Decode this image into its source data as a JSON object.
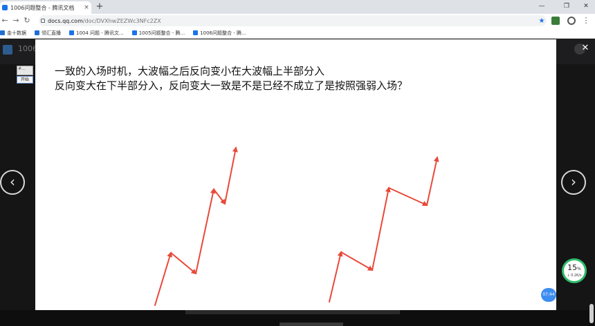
{
  "browser": {
    "tab_title": "1006问题整合 - 腾讯文档",
    "tab_close_glyph": "×",
    "new_tab_glyph": "+",
    "window_controls": [
      "—",
      "❐",
      "✕"
    ],
    "nav": {
      "back": "←",
      "forward": "→",
      "reload": "↻"
    },
    "url_host": "docs.qq.com",
    "url_path": "/doc/DVXhwZEZWc3NFc2ZX",
    "star_glyph": "★",
    "menu_glyph": "⋮"
  },
  "bookmarks": [
    {
      "label": "金十数据",
      "icon": "grid-icon",
      "color": "#1f6fd0"
    },
    {
      "label": "领汇直播",
      "icon": "play-icon",
      "color": "#1f6fd0"
    },
    {
      "label": "1004 问题 - 腾讯文...",
      "icon": "doc-icon",
      "color": "#1a73e8"
    },
    {
      "label": "1005问题整合 - 腾...",
      "icon": "doc-icon",
      "color": "#1a73e8"
    },
    {
      "label": "1006问题整合 - 腾...",
      "icon": "doc-icon",
      "color": "#1a73e8"
    }
  ],
  "background_doc": {
    "title": "1006",
    "widget_top": "#...",
    "widget_button": "开始"
  },
  "viewer": {
    "close_glyph": "✕",
    "prev_glyph": "‹",
    "next_glyph": "›",
    "caption_line1": "一致的入场时机，大波幅之后反向变小在大波幅上半部分入",
    "caption_line2": "反向变大在下半部分入，反向变大一致是不是已经不成立了是按照强弱入场？",
    "arrow_color": "#e8493a",
    "time_badge": "07:44"
  },
  "net_monitor": {
    "percent": "15",
    "percent_unit": "%",
    "speed": "↓ 0.2K/s",
    "ring_color": "#2ebc6a"
  },
  "colors": {
    "accent": "#1a73e8",
    "overlay": "#151515"
  }
}
